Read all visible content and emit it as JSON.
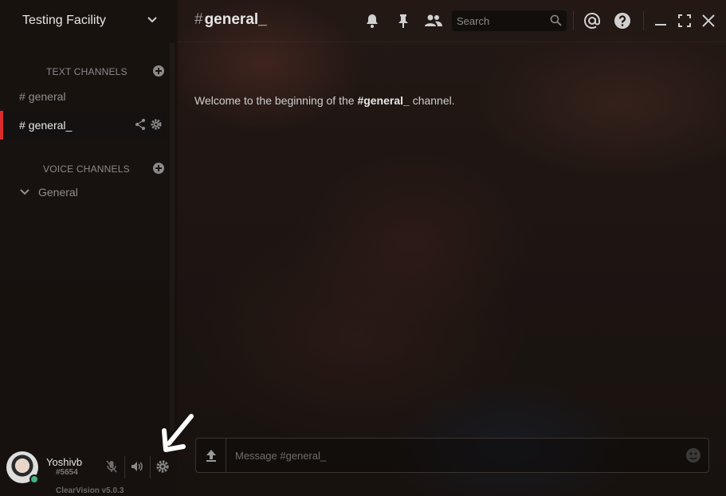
{
  "server": {
    "name": "Testing Facility"
  },
  "sidebar": {
    "text_category": "TEXT CHANNELS",
    "voice_category": "VOICE CHANNELS",
    "text_channels": [
      {
        "hash": "#",
        "name": "general"
      },
      {
        "hash": "#",
        "name": "general_"
      }
    ],
    "voice_channels": [
      {
        "name": "General"
      }
    ]
  },
  "user": {
    "name": "Yoshivb",
    "discriminator": "#5654",
    "status_color": "#43b581"
  },
  "footer": {
    "version": "ClearVision v5.0.3"
  },
  "header": {
    "hash": "#",
    "channel": "general_",
    "search_placeholder": "Search"
  },
  "main": {
    "welcome_prefix": "Welcome to the beginning of the ",
    "welcome_channel": "#general_",
    "welcome_suffix": " channel."
  },
  "composer": {
    "placeholder": "Message #general_"
  },
  "colors": {
    "active_indicator": "#d92d2d",
    "online": "#43b581"
  },
  "icons": [
    "chevron-down-icon",
    "plus-icon",
    "share-icon",
    "gear-icon",
    "bell-icon",
    "pin-icon",
    "members-icon",
    "search-icon",
    "mention-icon",
    "help-icon",
    "minimize-icon",
    "maximize-icon",
    "close-icon",
    "mic-icon",
    "speaker-icon",
    "upload-icon",
    "emoji-icon",
    "arrow-icon"
  ]
}
